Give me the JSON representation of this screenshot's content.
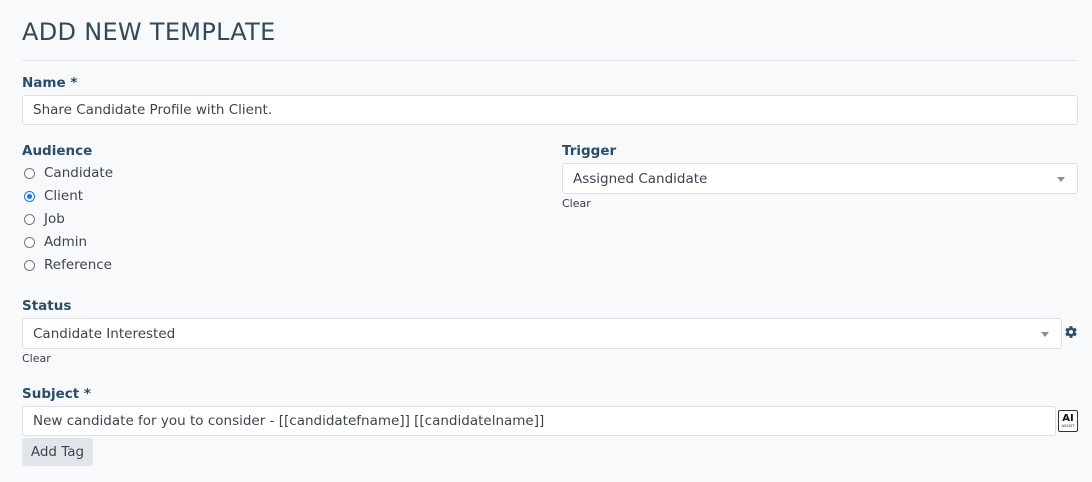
{
  "page": {
    "title": "ADD NEW TEMPLATE"
  },
  "name": {
    "label": "Name *",
    "value": "Share Candidate Profile with Client."
  },
  "audience": {
    "label": "Audience",
    "options": [
      "Candidate",
      "Client",
      "Job",
      "Admin",
      "Reference"
    ],
    "selected": "Client"
  },
  "trigger": {
    "label": "Trigger",
    "value": "Assigned Candidate",
    "clear_label": "Clear"
  },
  "status": {
    "label": "Status",
    "value": "Candidate Interested",
    "clear_label": "Clear",
    "settings_icon": "gear-icon"
  },
  "subject": {
    "label": "Subject *",
    "value": "New candidate for you to consider - [[candidatefname]] [[candidatelname]]",
    "ai_button": {
      "main": "AI",
      "sub": "ASSIST"
    },
    "add_tag_label": "Add Tag"
  }
}
